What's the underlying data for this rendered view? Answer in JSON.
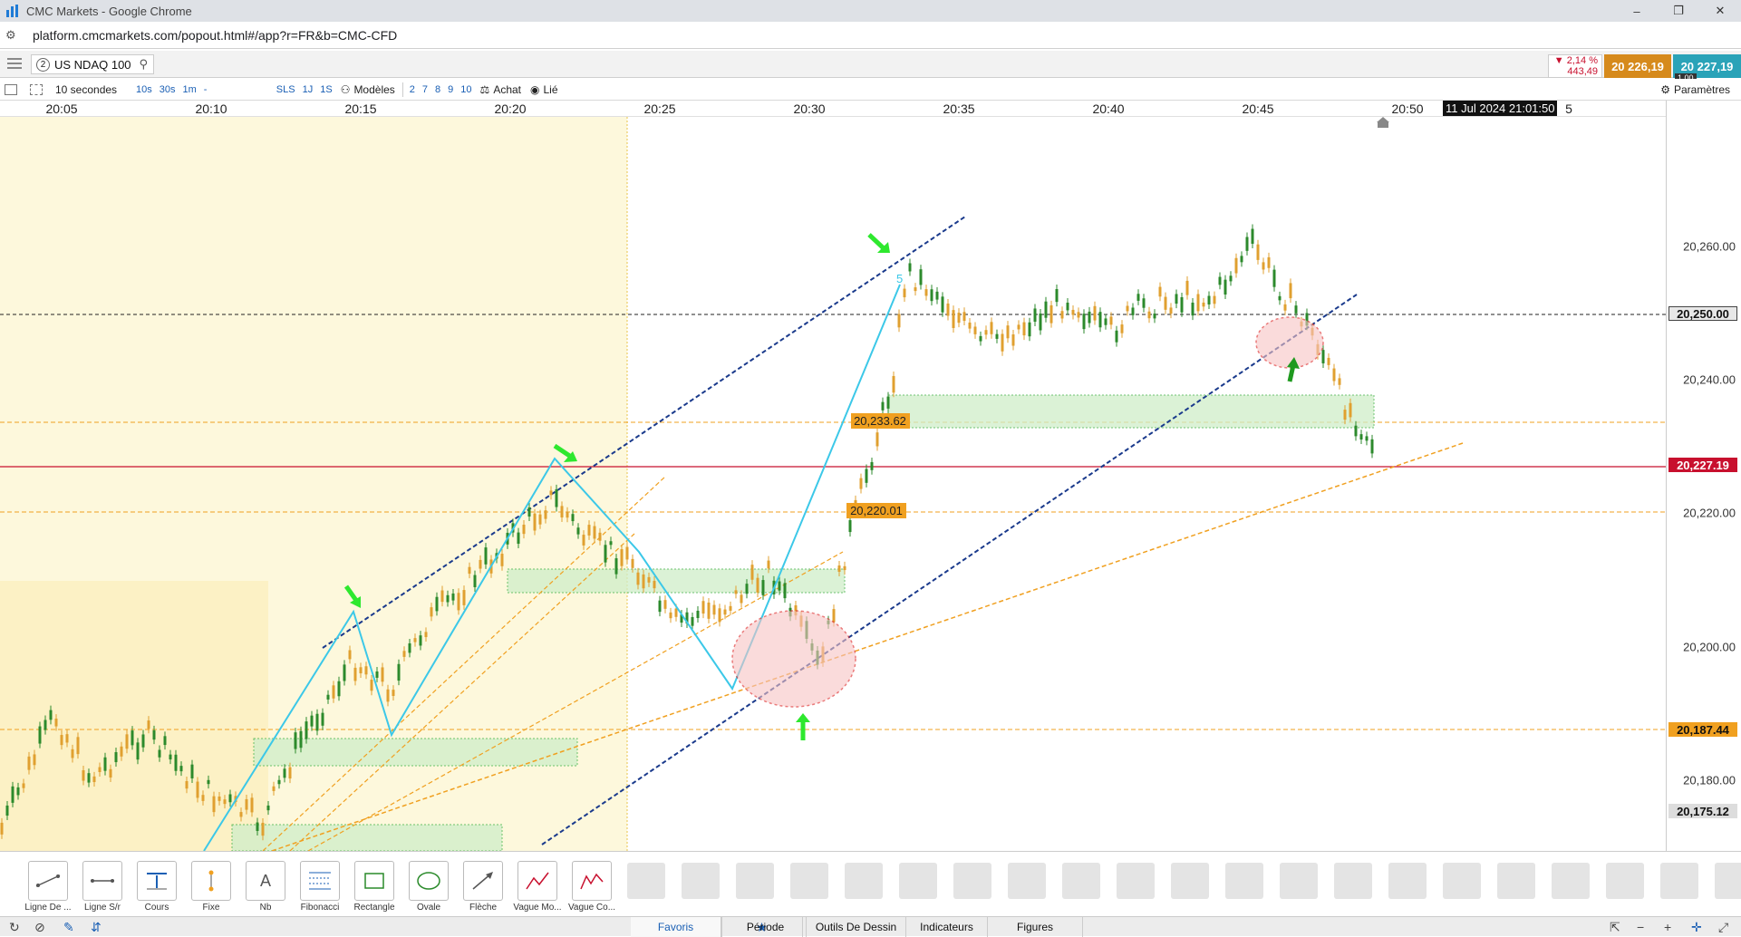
{
  "window": {
    "title": "CMC Markets - Google Chrome",
    "minimize": "–",
    "maximize": "❐",
    "close": "✕"
  },
  "browser": {
    "url": "platform.cmcmarkets.com/popout.html#/app?r=FR&b=CMC-CFD"
  },
  "instrument": {
    "index": "2",
    "symbol": "US NDAQ 100",
    "change_pct": "▼ 2,14 %",
    "change_pts": "443,49",
    "bid": "20 226,19",
    "ask": "20 227,19",
    "quantity": "1,00"
  },
  "toolbar": {
    "interval": "10 secondes",
    "quick_intervals": [
      "10s",
      "30s",
      "1m",
      "-"
    ],
    "sls": "SLS",
    "range_buttons": [
      "1J",
      "1S"
    ],
    "models": "Modèles",
    "model_counts": [
      "2",
      "7",
      "8",
      "9",
      "10"
    ],
    "buy": "Achat",
    "linked": "Lié",
    "settings": "Paramètres"
  },
  "time_axis": {
    "ticks": [
      "20:05",
      "20:10",
      "20:15",
      "20:20",
      "20:25",
      "20:30",
      "20:35",
      "20:40",
      "20:45",
      "20:50"
    ],
    "cursor_time": "11 Jul 2024 21:01:50",
    "cursor_suffix": "5"
  },
  "price_axis": {
    "labels": [
      "20,260.00",
      "20,240.00",
      "20,220.00",
      "20,200.00",
      "20,180.00"
    ],
    "tags": {
      "level_250": "20,250.00",
      "current": "20,227.19",
      "support": "20,187.44",
      "low": "20,175.12"
    },
    "colors": {
      "current": "#c8102e",
      "orange": "#f39c12",
      "dark": "#222222"
    }
  },
  "chart": {
    "in_chart_labels": {
      "level_233": "20,233.62",
      "level_220": "20,220.01",
      "wave5": "5"
    }
  },
  "tools": [
    {
      "label": "Ligne De ...",
      "icon": "line-icon"
    },
    {
      "label": "Ligne S/r",
      "icon": "sr-line-icon"
    },
    {
      "label": "Cours",
      "icon": "price-icon"
    },
    {
      "label": "Fixe",
      "icon": "fixed-icon"
    },
    {
      "label": "Nb",
      "icon": "text-icon"
    },
    {
      "label": "Fibonacci",
      "icon": "fibonacci-icon"
    },
    {
      "label": "Rectangle",
      "icon": "rectangle-icon"
    },
    {
      "label": "Ovale",
      "icon": "oval-icon"
    },
    {
      "label": "Flèche",
      "icon": "arrow-icon"
    },
    {
      "label": "Vague Mo...",
      "icon": "wave-motive-icon"
    },
    {
      "label": "Vague Co...",
      "icon": "wave-corrective-icon"
    }
  ],
  "tabs": [
    "Favoris",
    "Période",
    "Outils De Dessin",
    "Indicateurs",
    "Figures"
  ],
  "tool_glyphs": {
    "text": "A"
  }
}
